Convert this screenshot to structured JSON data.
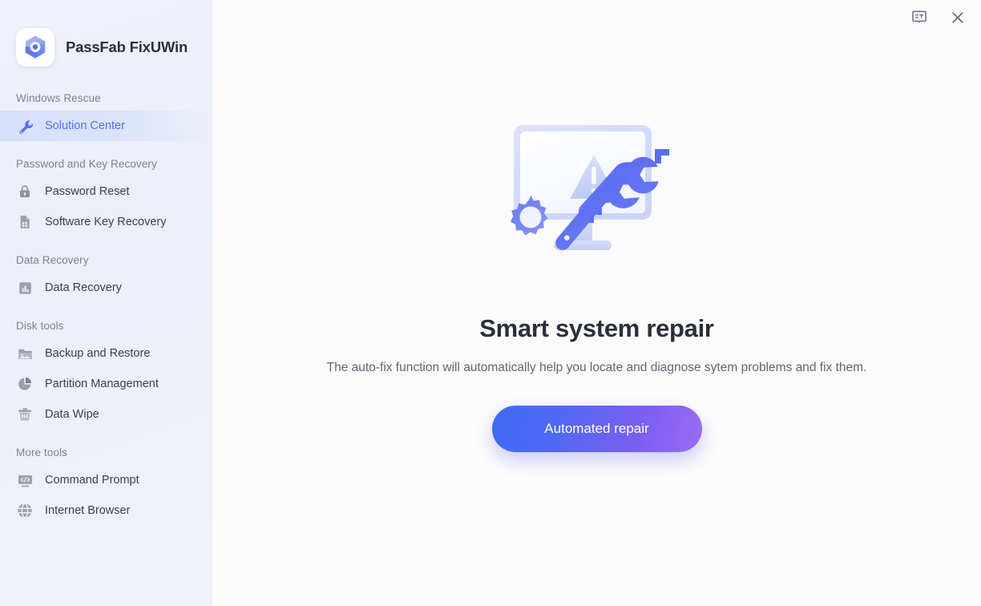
{
  "app": {
    "title": "PassFab FixUWin",
    "logo_icon": "hexagon-bolt-logo-icon"
  },
  "titlebar": {
    "feedback_icon": "translate-speech-bubble-icon",
    "feedback_label": "ET",
    "close_icon": "close-icon"
  },
  "sidebar": {
    "groups": [
      {
        "label": "Windows Rescue",
        "items": [
          {
            "label": "Solution Center",
            "icon": "wrench-icon",
            "active": true
          }
        ]
      },
      {
        "label": "Password and Key Recovery",
        "items": [
          {
            "label": "Password Reset",
            "icon": "lock-icon",
            "active": false
          },
          {
            "label": "Software Key Recovery",
            "icon": "document-key-icon",
            "active": false
          }
        ]
      },
      {
        "label": "Data Recovery",
        "items": [
          {
            "label": "Data Recovery",
            "icon": "bar-chart-icon",
            "active": false
          }
        ]
      },
      {
        "label": "Disk tools",
        "items": [
          {
            "label": "Backup and Restore",
            "icon": "folder-icon",
            "active": false
          },
          {
            "label": "Partition Management",
            "icon": "pie-chart-icon",
            "active": false
          },
          {
            "label": "Data Wipe",
            "icon": "trash-icon",
            "active": false
          }
        ]
      },
      {
        "label": "More tools",
        "items": [
          {
            "label": "Command Prompt",
            "icon": "terminal-code-icon",
            "active": false
          },
          {
            "label": "Internet Browser",
            "icon": "globe-icon",
            "active": false
          }
        ]
      }
    ]
  },
  "main": {
    "illustration_icon": "monitor-warning-wrench-gear-illustration",
    "headline": "Smart system repair",
    "description": "The auto-fix function will automatically help you locate and diagnose sytem problems and fix them.",
    "cta_label": "Automated repair"
  },
  "colors": {
    "accent_blue": "#5b6ef0",
    "cta_gradient_start": "#3f6bf5",
    "cta_gradient_end": "#9a6cf2",
    "sidebar_bg": "#eef1fa",
    "main_bg": "#fbfbfc",
    "heading_text": "#2b2f3a",
    "muted_text": "#7c8293"
  }
}
